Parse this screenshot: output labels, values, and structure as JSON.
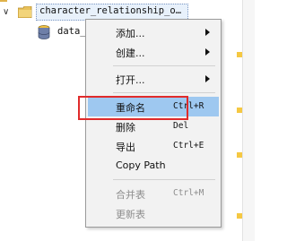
{
  "tree": {
    "folder_label": "character_relationship_o…",
    "child_label": "data_"
  },
  "menu": {
    "items": [
      {
        "label": "添加...",
        "shortcut": "",
        "submenu": true,
        "disabled": false,
        "highlighted": false
      },
      {
        "label": "创建...",
        "shortcut": "",
        "submenu": true,
        "disabled": false,
        "highlighted": false
      },
      {
        "label": "打开...",
        "shortcut": "",
        "submenu": true,
        "disabled": false,
        "highlighted": false
      },
      {
        "label": "重命名",
        "shortcut": "Ctrl+R",
        "submenu": false,
        "disabled": false,
        "highlighted": true
      },
      {
        "label": "删除",
        "shortcut": "Del",
        "submenu": false,
        "disabled": false,
        "highlighted": false
      },
      {
        "label": "导出",
        "shortcut": "Ctrl+E",
        "submenu": false,
        "disabled": false,
        "highlighted": false
      },
      {
        "label": "Copy Path",
        "shortcut": "",
        "submenu": false,
        "disabled": false,
        "highlighted": false
      },
      {
        "label": "合并表",
        "shortcut": "Ctrl+M",
        "submenu": false,
        "disabled": true,
        "highlighted": false
      },
      {
        "label": "更新表",
        "shortcut": "",
        "submenu": false,
        "disabled": true,
        "highlighted": false
      }
    ]
  },
  "colors": {
    "highlight": "#9ec8f0",
    "annotation_box": "#e02b2b",
    "folder": "#e8c15a"
  }
}
